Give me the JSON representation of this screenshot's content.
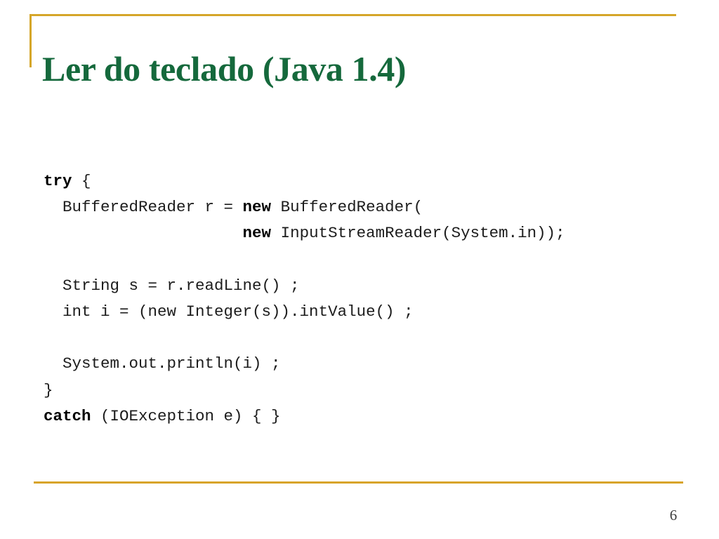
{
  "slide": {
    "title": "Ler do teclado (Java 1.4)",
    "page_number": "6",
    "accent_color": "#d5a629",
    "title_color": "#15693c",
    "background_color": "#ffffff",
    "code_color": "#1c1c1c"
  },
  "code": {
    "language": "java",
    "lines": [
      {
        "id": "line-try",
        "segments": [
          {
            "text": "try",
            "bold": true
          },
          {
            "text": " {",
            "bold": false
          }
        ],
        "plain": "try {"
      },
      {
        "id": "line-bufferedreader",
        "segments": [
          {
            "text": "  BufferedReader r = ",
            "bold": false
          },
          {
            "text": "new",
            "bold": true
          },
          {
            "text": " BufferedReader(",
            "bold": false
          }
        ],
        "plain": "  BufferedReader r = new BufferedReader("
      },
      {
        "id": "line-inputstreamreader",
        "segments": [
          {
            "text": "                     ",
            "bold": false
          },
          {
            "text": "new",
            "bold": true
          },
          {
            "text": " InputStreamReader(System.in));",
            "bold": false
          }
        ],
        "plain": "                     new InputStreamReader(System.in));"
      },
      {
        "id": "line-blank-1",
        "segments": [
          {
            "text": " ",
            "bold": false
          }
        ],
        "plain": " "
      },
      {
        "id": "line-readline",
        "segments": [
          {
            "text": "  String s = r.readLine() ;",
            "bold": false
          }
        ],
        "plain": "  String s = r.readLine() ;"
      },
      {
        "id": "line-intvalue",
        "segments": [
          {
            "text": "  int i = (new Integer(s)).intValue() ;",
            "bold": false
          }
        ],
        "plain": "  int i = (new Integer(s)).intValue() ;"
      },
      {
        "id": "line-blank-2",
        "segments": [
          {
            "text": " ",
            "bold": false
          }
        ],
        "plain": " "
      },
      {
        "id": "line-println",
        "segments": [
          {
            "text": "  System.out.println(i) ;",
            "bold": false
          }
        ],
        "plain": "  System.out.println(i) ;"
      },
      {
        "id": "line-close-brace",
        "segments": [
          {
            "text": "}",
            "bold": false
          }
        ],
        "plain": "}"
      },
      {
        "id": "line-catch",
        "segments": [
          {
            "text": "catch",
            "bold": true
          },
          {
            "text": " (IOException e) { }",
            "bold": false
          }
        ],
        "plain": "catch (IOException e) { }"
      }
    ]
  }
}
